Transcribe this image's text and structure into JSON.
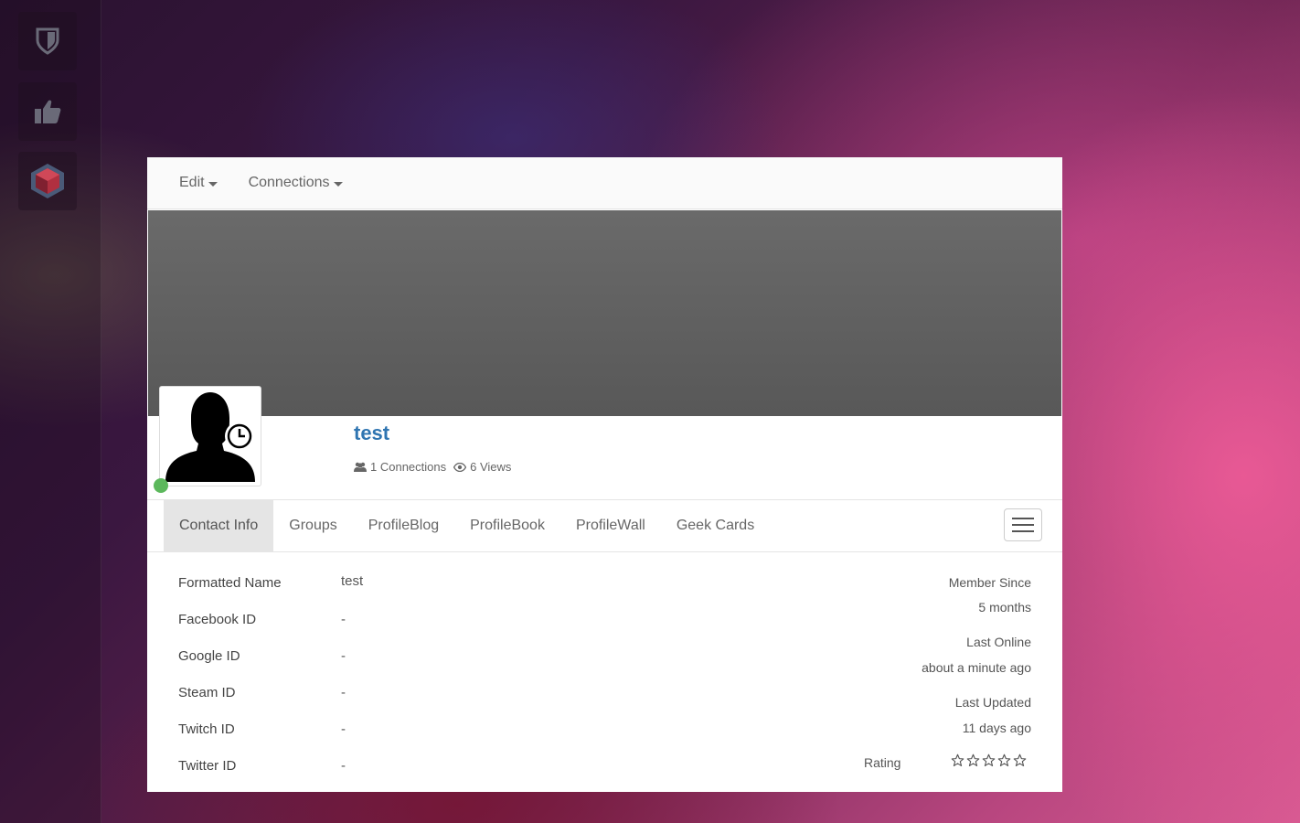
{
  "sidebar": {
    "items": [
      {
        "name": "shield"
      },
      {
        "name": "thumbs-up"
      },
      {
        "name": "game-cube"
      }
    ]
  },
  "topnav": {
    "edit_label": "Edit",
    "connections_label": "Connections"
  },
  "profile": {
    "username": "test",
    "connections_text": "1 Connections",
    "views_text": "6 Views",
    "online_color": "#5cb85c",
    "username_color": "#2f75b1"
  },
  "tabs": [
    {
      "label": "Contact Info",
      "active": true
    },
    {
      "label": "Groups"
    },
    {
      "label": "ProfileBlog"
    },
    {
      "label": "ProfileBook"
    },
    {
      "label": "ProfileWall"
    },
    {
      "label": "Geek Cards"
    }
  ],
  "contact": {
    "rows": [
      {
        "label": "Formatted Name",
        "value": "test"
      },
      {
        "label": "Facebook ID",
        "value": "-"
      },
      {
        "label": "Google ID",
        "value": "-"
      },
      {
        "label": "Steam ID",
        "value": "-"
      },
      {
        "label": "Twitch ID",
        "value": "-"
      },
      {
        "label": "Twitter ID",
        "value": "-"
      }
    ]
  },
  "status": {
    "member_since_label": "Member Since",
    "member_since_value": "5 months",
    "last_online_label": "Last Online",
    "last_online_value": "about a minute ago",
    "last_updated_label": "Last Updated",
    "last_updated_value": "11 days ago",
    "rating_label": "Rating",
    "rating_value": 0,
    "rating_max": 5
  }
}
